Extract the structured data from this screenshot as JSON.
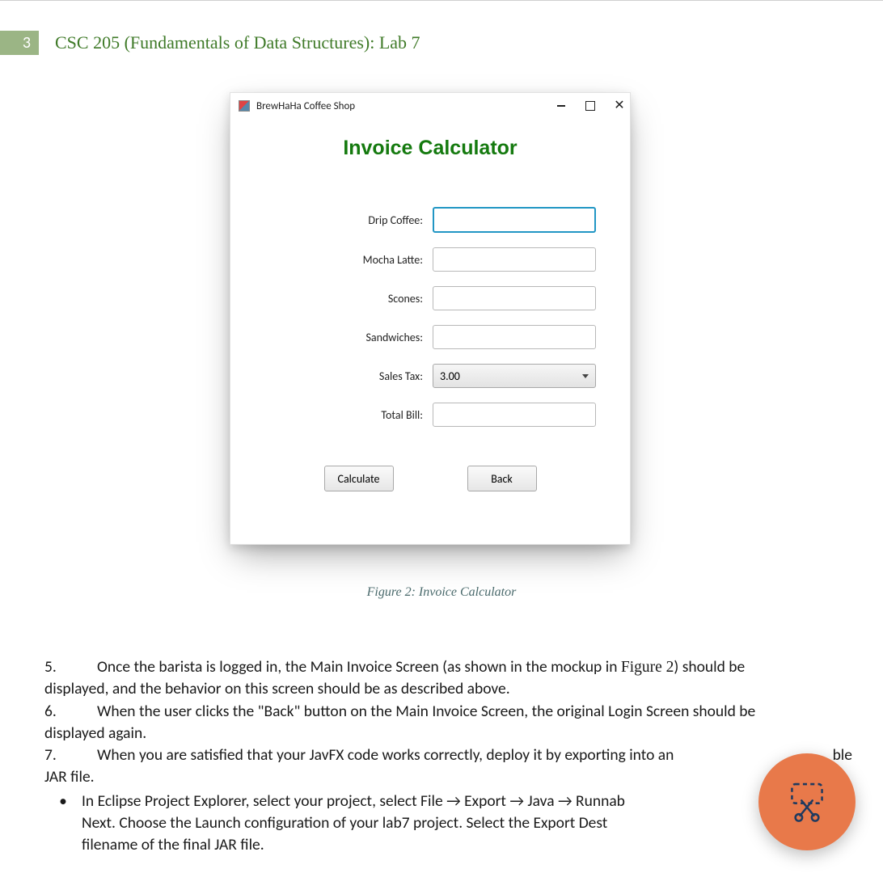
{
  "header": {
    "page_number": "3",
    "course_title": "CSC 205 (Fundamentals of Data Structures): Lab 7"
  },
  "app": {
    "window_title": "BrewHaHa Coffee Shop",
    "heading": "Invoice Calculator",
    "fields": {
      "drip_coffee_label": "Drip Coffee:",
      "mocha_latte_label": "Mocha Latte:",
      "scones_label": "Scones:",
      "sandwiches_label": "Sandwiches:",
      "sales_tax_label": "Sales Tax:",
      "sales_tax_value": "3.00",
      "total_bill_label": "Total Bill:"
    },
    "buttons": {
      "calculate": "Calculate",
      "back": "Back"
    }
  },
  "figure_caption": "Figure 2: Invoice Calculator",
  "text": {
    "item5_num": "5.",
    "item5_lead": "Once the barista is logged in, the Main Invoice Screen (as shown in the mockup in ",
    "item5_figref": "Figure 2",
    "item5_tail_line1": ") should be",
    "item5_line2": "displayed, and the behavior on this screen should be as described above.",
    "item6_num": "6.",
    "item6_line1": "When the user clicks the \"Back\" button on the Main Invoice Screen, the original Login Screen should be",
    "item6_line2": "displayed again.",
    "item7_num": "7.",
    "item7_line1a": "When you are satisfied that your JavFX code works correctly, deploy it by exporting into an ",
    "item7_line1b": "ble",
    "item7_line2": "JAR file.",
    "bullet_line1": "In Eclipse Project Explorer, select your project, select File → Export → Java → Runnab",
    "bullet_line2": "Next. Choose the Launch configuration of your lab7 project. Select the Export Dest",
    "bullet_line3": "filename of the final JAR file."
  }
}
